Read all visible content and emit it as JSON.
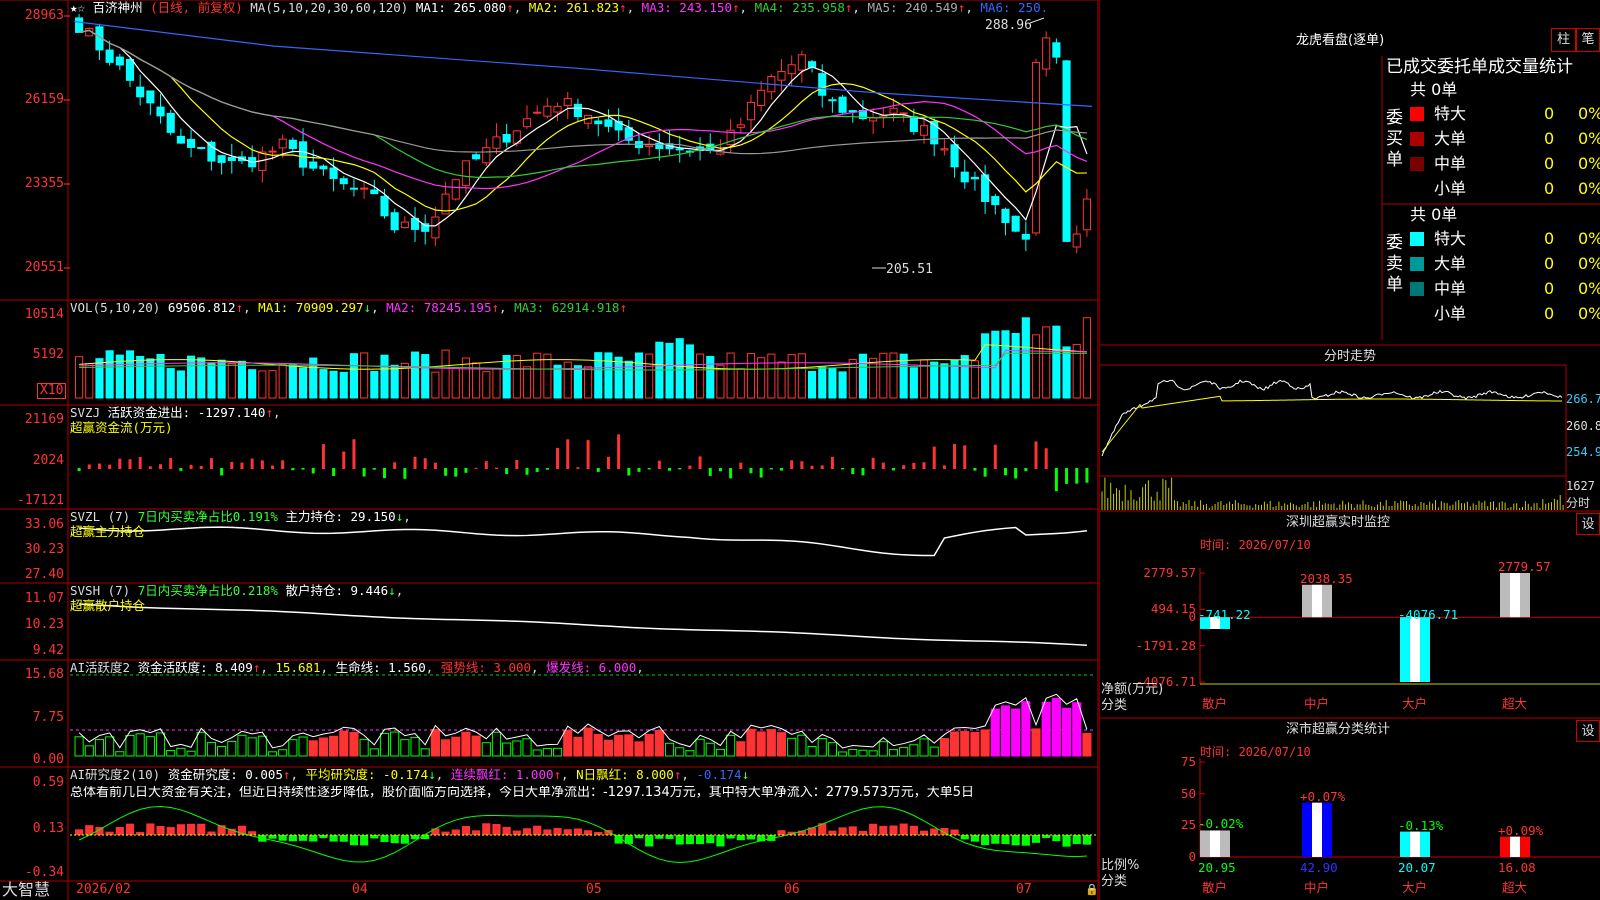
{
  "stock": {
    "favorite_icon": "★",
    "name": "百济神州",
    "period": "(日线, 前复权)"
  },
  "colors": {
    "up": "#ff3333",
    "down": "#00ffff",
    "ma1": "#ffffff",
    "ma2": "#ffff00",
    "ma3": "#ff33ff",
    "ma4": "#33cc33",
    "ma5": "#999999",
    "ma6": "#3366ff",
    "grid": "#b00000",
    "text": "#dddddd"
  },
  "main_chart": {
    "ma_title": "MA(5,10,20,30,60,120)",
    "ma_values": [
      {
        "label": "MA1: 265.080",
        "arrow": "↑",
        "color": "#ffffff"
      },
      {
        "label": "MA2: 261.823",
        "arrow": "↑",
        "color": "#ffff00"
      },
      {
        "label": "MA3: 243.150",
        "arrow": "↑",
        "color": "#ff33ff"
      },
      {
        "label": "MA4: 235.958",
        "arrow": "↑",
        "color": "#33cc33"
      },
      {
        "label": "MA5: 240.549",
        "arrow": "↑",
        "color": "#aaaaaa"
      },
      {
        "label": "MA6: 250.",
        "arrow": "",
        "color": "#3366ff"
      }
    ],
    "y_ticks": [
      "28963",
      "26159",
      "23355",
      "20551"
    ],
    "high_marker": "288.96",
    "low_marker": "205.51",
    "chart_data": {
      "type": "candlestick",
      "ylim": [
        199.0,
        291.0
      ],
      "high": 288.96,
      "low": 205.51,
      "count": 100
    }
  },
  "volume": {
    "title": "VOL(5,10,20)",
    "value": "69506.812",
    "arrow": "↑",
    "ma": [
      {
        "label": "MA1: 70909.297",
        "arrow": "↓",
        "color": "#ffff00"
      },
      {
        "label": "MA2: 78245.195",
        "arrow": "↑",
        "color": "#ff33ff"
      },
      {
        "label": "MA3: 62914.918",
        "arrow": "↑",
        "color": "#33cc33"
      }
    ],
    "y_ticks": [
      "10514",
      "5192"
    ],
    "unit_badge": "X10"
  },
  "svzj": {
    "title": "SVZJ",
    "label": "活跃资金进出: -1297.140",
    "arrow": "↑",
    "subtitle": "超赢资金流(万元)",
    "y_ticks": [
      "21169",
      "2024",
      "-17121"
    ]
  },
  "svzl": {
    "title": "SVZL (7)",
    "label1": "7日内买卖净占比0.191%",
    "label2": "主力持仓: 29.150",
    "arrow": "↓",
    "subtitle": "超赢主力持仓",
    "y_ticks": [
      "33.06",
      "30.23",
      "27.40"
    ]
  },
  "svsh": {
    "title": "SVSH (7)",
    "label1": "7日内买卖净占比0.218%",
    "label2": "散户持仓: 9.446",
    "arrow": "↓",
    "subtitle": "超赢散户持仓",
    "y_ticks": [
      "11.07",
      "10.23",
      "9.42"
    ]
  },
  "ai_activity": {
    "title": "AI活跃度2",
    "label1": "资金活跃度: 8.409",
    "arrow1": "↑",
    "label2": "15.681",
    "label3": "生命线: 1.560",
    "label4": "强势线: 3.000",
    "label5": "爆发线: 6.000",
    "y_ticks": [
      "15.68",
      "7.75",
      "0.00"
    ]
  },
  "ai_research": {
    "title": "AI研究度2(10)",
    "label1": "资金研究度: 0.005",
    "arrow1": "↑",
    "label2": "平均研究度: -0.174",
    "arrow2": "↓",
    "label3": "连续飘红: 1.000",
    "arrow3": "↑",
    "label4": "N日飘红: 8.000",
    "arrow4": "↑",
    "label5": "-0.174",
    "arrow5": "↓",
    "summary": "总体看前几日大资金有关注，但近日持续性逐步降低，股价面临方向选择，今日大单净流出：-1297.134万元，其中特大单净流入：2779.573万元，大单5日",
    "y_ticks": [
      "0.59",
      "0.13",
      "-0.34"
    ]
  },
  "bottom_bar": {
    "logo": "大智慧",
    "dates": [
      "2026/02",
      "04",
      "05",
      "06",
      "07"
    ]
  },
  "right_panel": {
    "longhu_title": "龙虎看盘(逐单)",
    "btn_bar": "柱",
    "btn_pen": "笔",
    "stat_title": "已成交委托单成交量统计",
    "buy_group": {
      "label": "委买单",
      "total": "共 0单",
      "rows": [
        {
          "name": "特大",
          "count": "0",
          "pct": "0%",
          "color": "#ff0000"
        },
        {
          "name": "大单",
          "count": "0",
          "pct": "0%",
          "color": "#aa0000"
        },
        {
          "name": "中单",
          "count": "0",
          "pct": "0%",
          "color": "#770000"
        },
        {
          "name": "小单",
          "count": "0",
          "pct": "0%",
          "color": ""
        }
      ]
    },
    "sell_group": {
      "label": "委卖单",
      "total": "共 0单",
      "rows": [
        {
          "name": "特大",
          "count": "0",
          "pct": "0%",
          "color": "#00ffff"
        },
        {
          "name": "大单",
          "count": "0",
          "pct": "0%",
          "color": "#009999"
        },
        {
          "name": "中单",
          "count": "0",
          "pct": "0%",
          "color": "#007777"
        },
        {
          "name": "小单",
          "count": "0",
          "pct": "0%",
          "color": ""
        }
      ]
    },
    "intraday": {
      "title": "分时走势",
      "price_ticks": [
        "266.7",
        "260.8",
        "254.9"
      ],
      "vol_tick": "1627",
      "vol_label": "分时"
    },
    "sz_monitor": {
      "title": "深圳超赢实时监控",
      "settings": "设",
      "time": "时间: 2026/07/10",
      "y_ticks": [
        "2779.57",
        "494.15",
        "0",
        "-1791.28",
        "-4076.71"
      ],
      "y_label": "净额(万元)",
      "x_caption": "分类",
      "chart_data": {
        "type": "bar",
        "categories": [
          "散户",
          "中户",
          "大户",
          "超大"
        ],
        "values": [
          -741.22,
          2038.35,
          -4076.71,
          2779.57
        ],
        "ylim": [
          -4076.71,
          2779.57
        ]
      }
    },
    "sz_class": {
      "title": "深市超赢分类统计",
      "settings": "设",
      "time": "时间: 2026/07/10",
      "y_ticks": [
        "75",
        "50",
        "25",
        "0"
      ],
      "y_label": "比例%",
      "x_caption": "分类",
      "chart_data": {
        "type": "bar",
        "categories": [
          "散户",
          "中户",
          "大户",
          "超大"
        ],
        "values": [
          20.95,
          42.9,
          20.07,
          16.08
        ],
        "changes": [
          "-0.02%",
          "+0.07%",
          "-0.13%",
          "+0.09%"
        ],
        "ylim": [
          0,
          75
        ]
      }
    }
  }
}
